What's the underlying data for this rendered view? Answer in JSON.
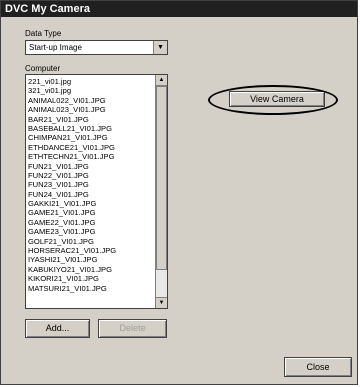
{
  "window": {
    "title": "DVC My Camera"
  },
  "data_type": {
    "label": "Data Type",
    "selected": "Start-up Image"
  },
  "computer": {
    "label": "Computer",
    "files": [
      "221_vi01.jpg",
      "321_vi01.jpg",
      "ANIMAL022_VI01.JPG",
      "ANIMAL023_VI01.JPG",
      "BAR21_VI01.JPG",
      "BASEBALL21_VI01.JPG",
      "CHIMPAN21_VI01.JPG",
      "ETHDANCE21_VI01.JPG",
      "ETHTECHN21_VI01.JPG",
      "FUN21_VI01.JPG",
      "FUN22_VI01.JPG",
      "FUN23_VI01.JPG",
      "FUN24_VI01.JPG",
      "GAKKI21_VI01.JPG",
      "GAME21_VI01.JPG",
      "GAME22_VI01.JPG",
      "GAME23_VI01.JPG",
      "GOLF21_VI01.JPG",
      "HORSERAC21_VI01.JPG",
      "IYASHI21_VI01.JPG",
      "KABUKIYO21_VI01.JPG",
      "KIKORI21_VI01.JPG",
      "MATSURI21_VI01.JPG"
    ]
  },
  "buttons": {
    "view_camera": "View Camera",
    "add": "Add...",
    "delete": "Delete",
    "close": "Close"
  },
  "icons": {
    "dropdown": "chevron-down-icon",
    "scroll_up": "arrow-up-icon",
    "scroll_down": "arrow-down-icon"
  }
}
